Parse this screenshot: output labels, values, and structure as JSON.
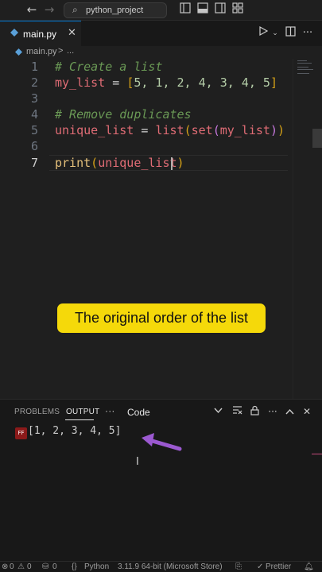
{
  "titlebar": {
    "back_glyph": "←",
    "forward_glyph": "→",
    "search_text": "python_project",
    "layout_icons": [
      "layout-sidebar-left-icon",
      "layout-panel-icon",
      "layout-sidebar-right-icon",
      "customize-layout-icon"
    ]
  },
  "tab": {
    "label": "main.py",
    "close_glyph": "✕"
  },
  "breadcrumb": {
    "file": "main.py",
    "separator": ">",
    "more": "..."
  },
  "editor": {
    "lines": [
      {
        "num": "1",
        "comment": "# Create a list"
      },
      {
        "num": "2"
      },
      {
        "num": "3"
      },
      {
        "num": "4",
        "comment": "# Remove duplicates"
      },
      {
        "num": "5"
      },
      {
        "num": "6"
      },
      {
        "num": "7"
      }
    ],
    "line2": {
      "var": "my_list",
      "op": " = ",
      "open": "[",
      "items": "5, 1, 2, 4, 3, 4, 5",
      "close": "]"
    },
    "line5": {
      "var": "unique_list",
      "op": " = ",
      "fn1": "list",
      "p1": "(",
      "fn2": "set",
      "p2": "(",
      "arg": "my_list",
      "p3": ")",
      "p4": ")"
    },
    "line7": {
      "fn": "print",
      "p1": "(",
      "arg": "unique_list",
      "p2": ")"
    }
  },
  "caption": "The original order of the list",
  "panel": {
    "tabs": [
      "PROBLEMS",
      "OUTPUT"
    ],
    "more": "···",
    "selected_channel": "Code",
    "badge": "FF",
    "output": "[1, 2, 3, 4, 5]",
    "accent_color": "#9b59d0"
  },
  "statusbar": {
    "errors": "0",
    "warnings": "0",
    "ports": "0",
    "braces": "{}",
    "language": "Python",
    "interpreter": "3.11.9 64-bit (Microsoft Store)",
    "formatter": "Prettier"
  }
}
